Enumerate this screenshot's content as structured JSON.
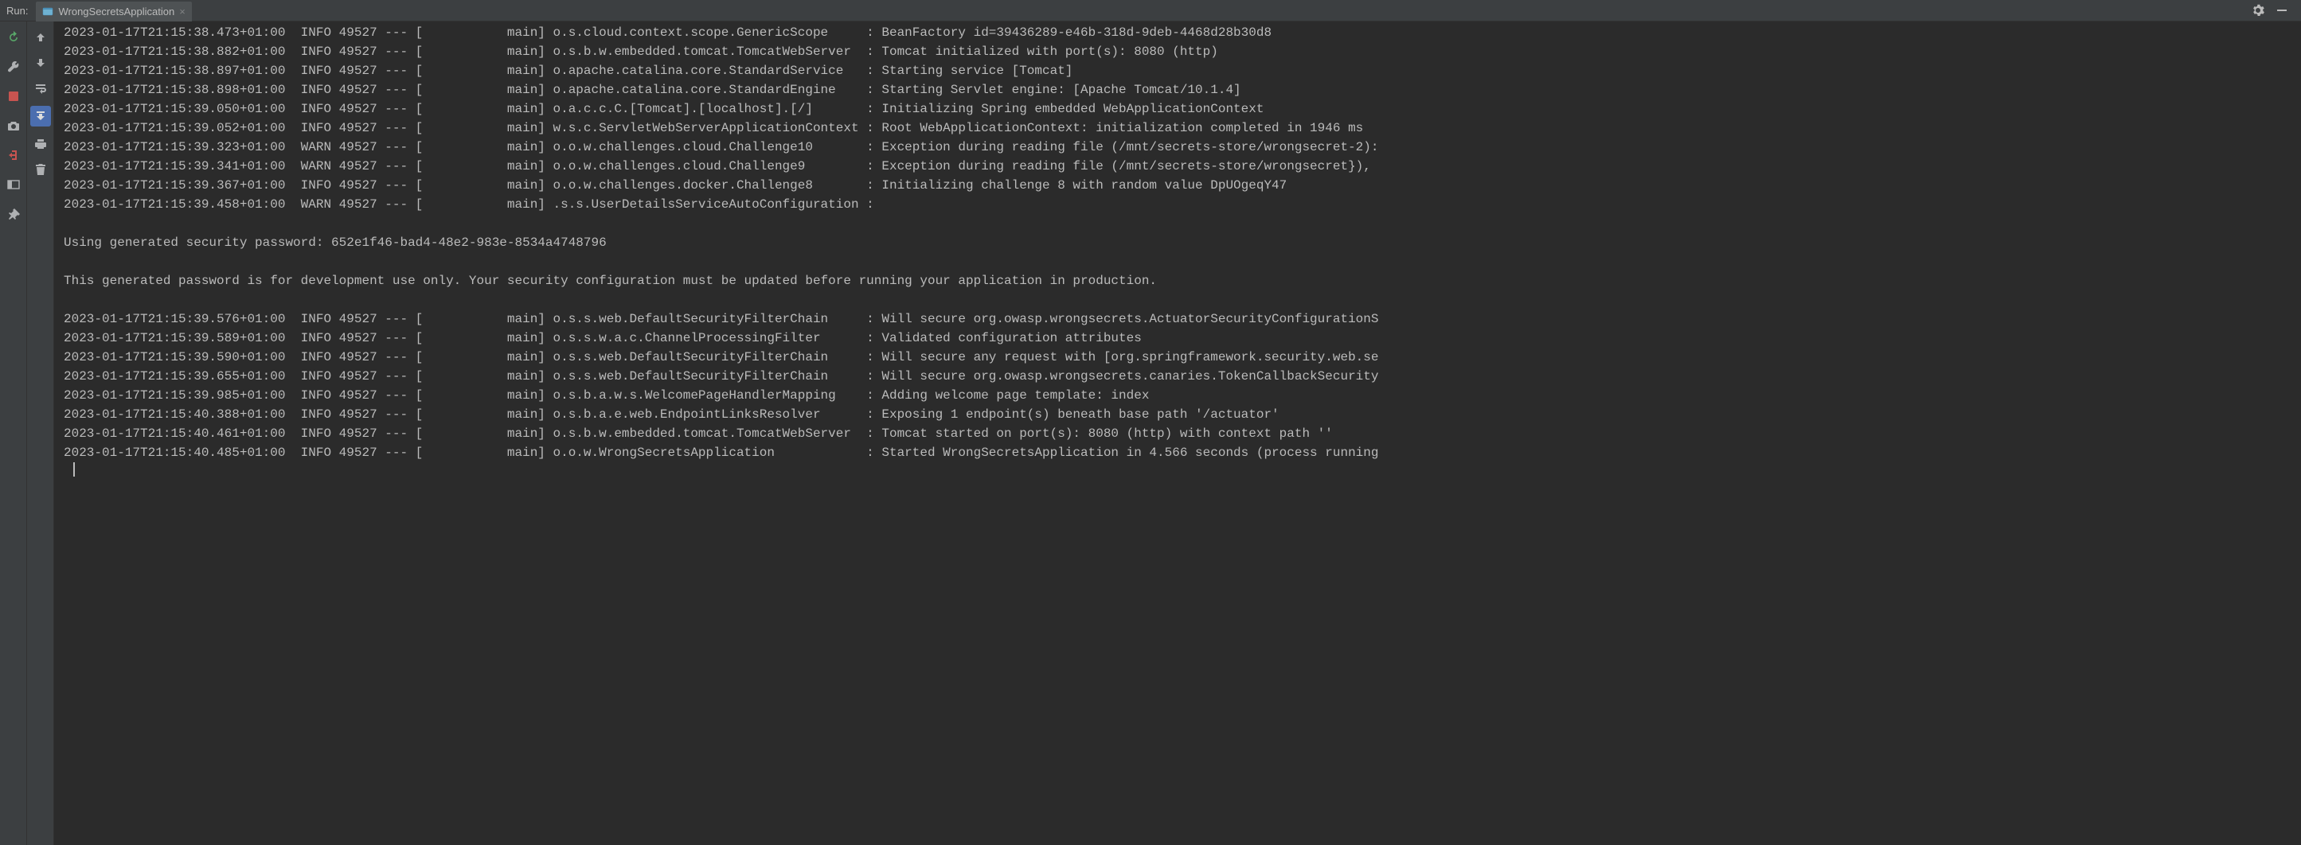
{
  "header": {
    "run_label": "Run:",
    "tab_name": "WrongSecretsApplication",
    "close_glyph": "×"
  },
  "log_lines": [
    "2023-01-17T21:15:38.473+01:00  INFO 49527 --- [           main] o.s.cloud.context.scope.GenericScope     : BeanFactory id=39436289-e46b-318d-9deb-4468d28b30d8",
    "2023-01-17T21:15:38.882+01:00  INFO 49527 --- [           main] o.s.b.w.embedded.tomcat.TomcatWebServer  : Tomcat initialized with port(s): 8080 (http)",
    "2023-01-17T21:15:38.897+01:00  INFO 49527 --- [           main] o.apache.catalina.core.StandardService   : Starting service [Tomcat]",
    "2023-01-17T21:15:38.898+01:00  INFO 49527 --- [           main] o.apache.catalina.core.StandardEngine    : Starting Servlet engine: [Apache Tomcat/10.1.4]",
    "2023-01-17T21:15:39.050+01:00  INFO 49527 --- [           main] o.a.c.c.C.[Tomcat].[localhost].[/]       : Initializing Spring embedded WebApplicationContext",
    "2023-01-17T21:15:39.052+01:00  INFO 49527 --- [           main] w.s.c.ServletWebServerApplicationContext : Root WebApplicationContext: initialization completed in 1946 ms",
    "2023-01-17T21:15:39.323+01:00  WARN 49527 --- [           main] o.o.w.challenges.cloud.Challenge10       : Exception during reading file (/mnt/secrets-store/wrongsecret-2):",
    "2023-01-17T21:15:39.341+01:00  WARN 49527 --- [           main] o.o.w.challenges.cloud.Challenge9        : Exception during reading file (/mnt/secrets-store/wrongsecret}),",
    "2023-01-17T21:15:39.367+01:00  INFO 49527 --- [           main] o.o.w.challenges.docker.Challenge8       : Initializing challenge 8 with random value DpUOgeqY47",
    "2023-01-17T21:15:39.458+01:00  WARN 49527 --- [           main] .s.s.UserDetailsServiceAutoConfiguration : ",
    "",
    "Using generated security password: 652e1f46-bad4-48e2-983e-8534a4748796",
    "",
    "This generated password is for development use only. Your security configuration must be updated before running your application in production.",
    "",
    "2023-01-17T21:15:39.576+01:00  INFO 49527 --- [           main] o.s.s.web.DefaultSecurityFilterChain     : Will secure org.owasp.wrongsecrets.ActuatorSecurityConfigurationS",
    "2023-01-17T21:15:39.589+01:00  INFO 49527 --- [           main] o.s.s.w.a.c.ChannelProcessingFilter      : Validated configuration attributes",
    "2023-01-17T21:15:39.590+01:00  INFO 49527 --- [           main] o.s.s.web.DefaultSecurityFilterChain     : Will secure any request with [org.springframework.security.web.se",
    "2023-01-17T21:15:39.655+01:00  INFO 49527 --- [           main] o.s.s.web.DefaultSecurityFilterChain     : Will secure org.owasp.wrongsecrets.canaries.TokenCallbackSecurity",
    "2023-01-17T21:15:39.985+01:00  INFO 49527 --- [           main] o.s.b.a.w.s.WelcomePageHandlerMapping    : Adding welcome page template: index",
    "2023-01-17T21:15:40.388+01:00  INFO 49527 --- [           main] o.s.b.a.e.web.EndpointLinksResolver      : Exposing 1 endpoint(s) beneath base path '/actuator'",
    "2023-01-17T21:15:40.461+01:00  INFO 49527 --- [           main] o.s.b.w.embedded.tomcat.TomcatWebServer  : Tomcat started on port(s): 8080 (http) with context path ''",
    "2023-01-17T21:15:40.485+01:00  INFO 49527 --- [           main] o.o.w.WrongSecretsApplication            : Started WrongSecretsApplication in 4.566 seconds (process running"
  ]
}
